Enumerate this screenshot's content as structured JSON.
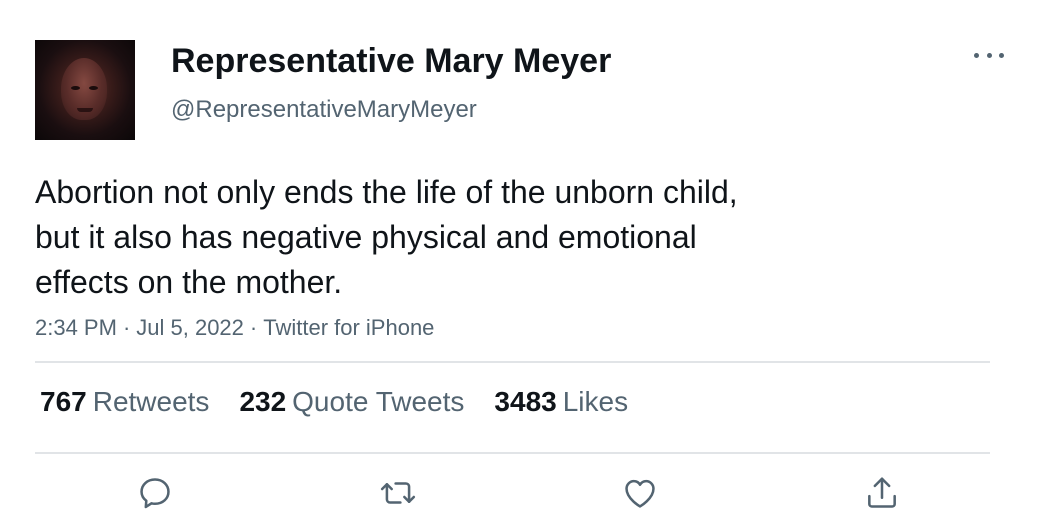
{
  "author": {
    "name": "Representative Mary Meyer",
    "handle": "@RepresentativeMaryMeyer"
  },
  "tweet": {
    "lines": [
      "Abortion not only ends the life of the unborn child,",
      "but it also has negative physical and emotional",
      "effects on the mother."
    ],
    "time": "2:34 PM",
    "date": "Jul 5, 2022",
    "source": "Twitter for iPhone",
    "separator": "·"
  },
  "stats": {
    "retweets": {
      "count": "767",
      "label": "Retweets"
    },
    "quotes": {
      "count": "232",
      "label": "Quote Tweets"
    },
    "likes": {
      "count": "3483",
      "label": "Likes"
    }
  },
  "icons": {
    "more": "more-horizontal-icon",
    "reply": "reply-icon",
    "retweet": "retweet-icon",
    "like": "heart-icon",
    "share": "share-icon"
  },
  "colors": {
    "text": "#0f1419",
    "secondary": "#536471",
    "divider": "#e1e4e7"
  }
}
